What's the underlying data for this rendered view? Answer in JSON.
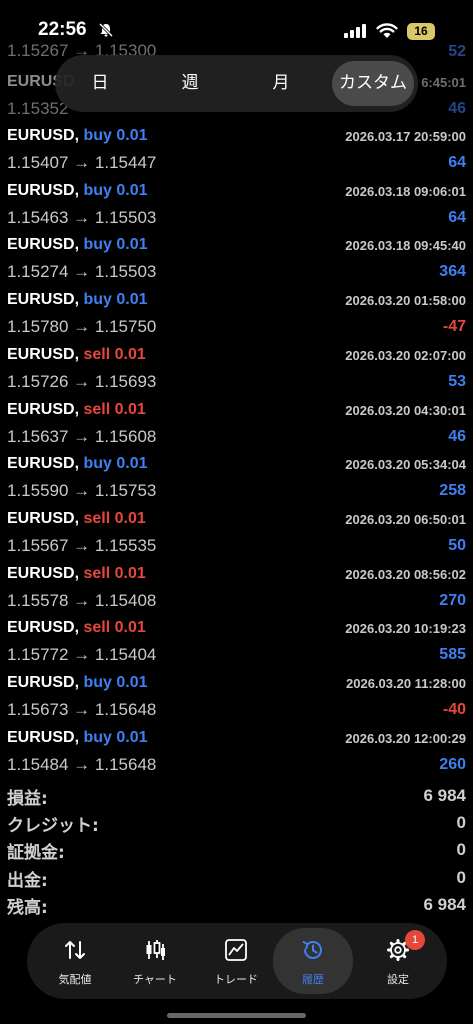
{
  "status_bar": {
    "time": "22:56",
    "battery": "16"
  },
  "period_tabs": {
    "day": "日",
    "week": "週",
    "month": "月",
    "custom": "カスタム",
    "selected": "カスタム"
  },
  "partial_rows": {
    "top_profit": "52",
    "prices_a": "1.15267 → 1.15300",
    "symbol_b": "EURUSD",
    "time_b": "6:45:01",
    "prices_b": "1.15352",
    "profit_b": "46"
  },
  "trades": [
    {
      "symbol": "EURUSD,",
      "side": "buy",
      "lots": "0.01",
      "time": "2026.03.17 20:59:00",
      "prices": "1.15407 → 1.15447",
      "profit": "64"
    },
    {
      "symbol": "EURUSD,",
      "side": "buy",
      "lots": "0.01",
      "time": "2026.03.18 09:06:01",
      "prices": "1.15463 → 1.15503",
      "profit": "64"
    },
    {
      "symbol": "EURUSD,",
      "side": "buy",
      "lots": "0.01",
      "time": "2026.03.18 09:45:40",
      "prices": "1.15274 → 1.15503",
      "profit": "364"
    },
    {
      "symbol": "EURUSD,",
      "side": "buy",
      "lots": "0.01",
      "time": "2026.03.20 01:58:00",
      "prices": "1.15780 → 1.15750",
      "profit": "-47"
    },
    {
      "symbol": "EURUSD,",
      "side": "sell",
      "lots": "0.01",
      "time": "2026.03.20 02:07:00",
      "prices": "1.15726 → 1.15693",
      "profit": "53"
    },
    {
      "symbol": "EURUSD,",
      "side": "sell",
      "lots": "0.01",
      "time": "2026.03.20 04:30:01",
      "prices": "1.15637 → 1.15608",
      "profit": "46"
    },
    {
      "symbol": "EURUSD,",
      "side": "buy",
      "lots": "0.01",
      "time": "2026.03.20 05:34:04",
      "prices": "1.15590 → 1.15753",
      "profit": "258"
    },
    {
      "symbol": "EURUSD,",
      "side": "sell",
      "lots": "0.01",
      "time": "2026.03.20 06:50:01",
      "prices": "1.15567 → 1.15535",
      "profit": "50"
    },
    {
      "symbol": "EURUSD,",
      "side": "sell",
      "lots": "0.01",
      "time": "2026.03.20 08:56:02",
      "prices": "1.15578 → 1.15408",
      "profit": "270"
    },
    {
      "symbol": "EURUSD,",
      "side": "sell",
      "lots": "0.01",
      "time": "2026.03.20 10:19:23",
      "prices": "1.15772 → 1.15404",
      "profit": "585"
    },
    {
      "symbol": "EURUSD,",
      "side": "buy",
      "lots": "0.01",
      "time": "2026.03.20 11:28:00",
      "prices": "1.15673 → 1.15648",
      "profit": "-40"
    },
    {
      "symbol": "EURUSD,",
      "side": "buy",
      "lots": "0.01",
      "time": "2026.03.20 12:00:29",
      "prices": "1.15484 → 1.15648",
      "profit": "260"
    }
  ],
  "summary": [
    {
      "label": "損益:",
      "value": "6 984"
    },
    {
      "label": "クレジット:",
      "value": "0"
    },
    {
      "label": "証拠金:",
      "value": "0"
    },
    {
      "label": "出金:",
      "value": "0"
    },
    {
      "label": "残高:",
      "value": "6 984"
    }
  ],
  "bottom_nav": {
    "items": [
      {
        "label": "気配値",
        "icon": "quotes-icon"
      },
      {
        "label": "チャート",
        "icon": "chart-icon"
      },
      {
        "label": "トレード",
        "icon": "trade-icon"
      },
      {
        "label": "履歴",
        "icon": "history-icon"
      },
      {
        "label": "設定",
        "icon": "gear-icon"
      }
    ],
    "active": "履歴",
    "settings_badge": "1"
  },
  "colors": {
    "buy": "#3f7ff0",
    "sell": "#e5483b",
    "background": "#000000"
  }
}
